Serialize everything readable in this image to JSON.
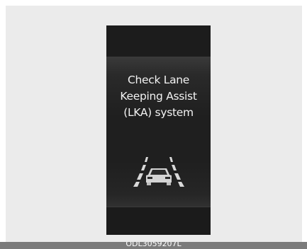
{
  "display": {
    "message_lines": [
      "Check Lane",
      "Keeping Assist",
      "(LKA) system"
    ],
    "icon": "lane-keeping-assist-icon"
  },
  "footer": {
    "code": "ODL3059207L"
  },
  "colors": {
    "panel_background": "#ebebeb",
    "display_background": "#232323",
    "text": "#f2f2f2",
    "footer_bar": "#7b7b7b"
  }
}
